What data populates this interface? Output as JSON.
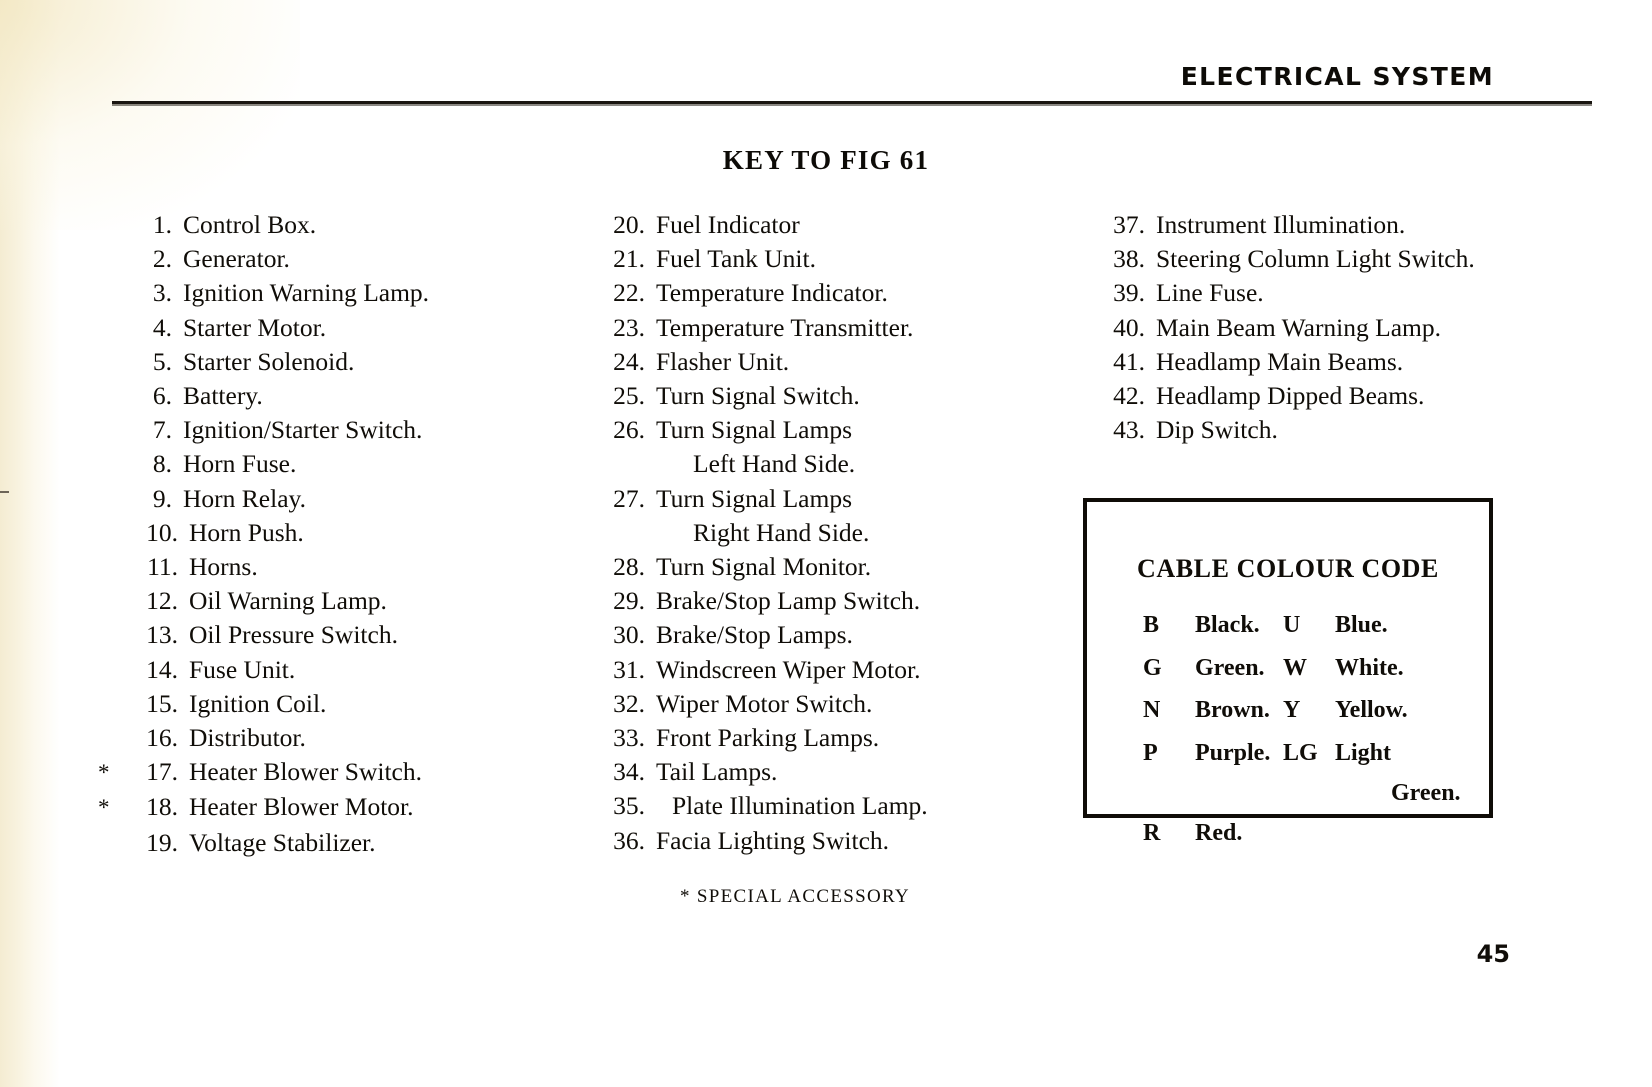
{
  "running_head": "ELECTRICAL SYSTEM",
  "key_title": "KEY TO FIG 61",
  "columns": [
    {
      "id": "column-1",
      "items": [
        {
          "star": "",
          "num": "1.",
          "label": "Control  Box."
        },
        {
          "star": "",
          "num": "2.",
          "label": "Generator."
        },
        {
          "star": "",
          "num": "3.",
          "label": "Ignition Warning Lamp."
        },
        {
          "star": "",
          "num": "4.",
          "label": "Starter Motor."
        },
        {
          "star": "",
          "num": "5.",
          "label": "Starter Solenoid."
        },
        {
          "star": "",
          "num": "6.",
          "label": "Battery."
        },
        {
          "star": "",
          "num": "7.",
          "label": "Ignition/Starter Switch."
        },
        {
          "star": "",
          "num": "8.",
          "label": "Horn Fuse."
        },
        {
          "star": "",
          "num": "9.",
          "label": "Horn Relay."
        },
        {
          "star": "",
          "num": "10.",
          "label": "Horn Push."
        },
        {
          "star": "",
          "num": "11.",
          "label": "Horns."
        },
        {
          "star": "",
          "num": "12.",
          "label": "Oil Warning Lamp."
        },
        {
          "star": "",
          "num": "13.",
          "label": "Oil Pressure Switch."
        },
        {
          "star": "",
          "num": "14.",
          "label": "Fuse Unit."
        },
        {
          "star": "",
          "num": "15.",
          "label": "Ignition Coil."
        },
        {
          "star": "",
          "num": "16.",
          "label": "Distributor."
        },
        {
          "star": "*",
          "num": "17.",
          "label": "Heater Blower Switch."
        },
        {
          "star": "*",
          "num": "18.",
          "label": "Heater Blower Motor."
        },
        {
          "star": "",
          "num": "19.",
          "label": "Voltage Stabilizer."
        }
      ]
    },
    {
      "id": "column-2",
      "items": [
        {
          "star": "",
          "num": "20.",
          "label": "Fuel Indicator"
        },
        {
          "star": "",
          "num": "21.",
          "label": "Fuel Tank Unit."
        },
        {
          "star": "",
          "num": "22.",
          "label": "Temperature Indicator."
        },
        {
          "star": "",
          "num": "23.",
          "label": "Temperature Transmitter."
        },
        {
          "star": "",
          "num": "24.",
          "label": "Flasher Unit."
        },
        {
          "star": "",
          "num": "25.",
          "label": "Turn Signal Switch."
        },
        {
          "star": "",
          "num": "26.",
          "label": "Turn Signal Lamps",
          "sub": "Left Hand Side."
        },
        {
          "star": "",
          "num": "27.",
          "label": "Turn Signal Lamps",
          "sub": "Right Hand Side."
        },
        {
          "star": "",
          "num": "28.",
          "label": "Turn Signal Monitor."
        },
        {
          "star": "",
          "num": "29.",
          "label": "Brake/Stop Lamp Switch."
        },
        {
          "star": "",
          "num": "30.",
          "label": "Brake/Stop Lamps."
        },
        {
          "star": "",
          "num": "31.",
          "label": "Windscreen Wiper Motor."
        },
        {
          "star": "",
          "num": "32.",
          "label": "Wiper Motor Switch."
        },
        {
          "star": "",
          "num": "33.",
          "label": "Front Parking Lamps."
        },
        {
          "star": "",
          "num": "34.",
          "label": "Tail Lamps."
        },
        {
          "star": "",
          "num": "35.",
          "label": "Plate Illumination Lamp.",
          "indent": true
        },
        {
          "star": "",
          "num": "36.",
          "label": "Facia Lighting Switch."
        }
      ]
    },
    {
      "id": "column-3",
      "items": [
        {
          "star": "",
          "num": "37.",
          "label": "Instrument Illumination."
        },
        {
          "star": "",
          "num": "38.",
          "label": "Steering Column Light Switch."
        },
        {
          "star": "",
          "num": "39.",
          "label": "Line Fuse."
        },
        {
          "star": "",
          "num": "40.",
          "label": "Main Beam Warning Lamp."
        },
        {
          "star": "",
          "num": "41.",
          "label": "Headlamp Main Beams."
        },
        {
          "star": "",
          "num": "42.",
          "label": "Headlamp Dipped Beams."
        },
        {
          "star": "",
          "num": "43.",
          "label": "Dip Switch."
        }
      ]
    }
  ],
  "cable_colour_code": {
    "title": "CABLE COLOUR CODE",
    "rows": [
      {
        "left_code": "B",
        "left_name": "Black.",
        "right_code": "U",
        "right_name": "Blue."
      },
      {
        "left_code": "G",
        "left_name": "Green.",
        "right_code": "W",
        "right_name": "White."
      },
      {
        "left_code": "N",
        "left_name": "Brown.",
        "right_code": "Y",
        "right_name": "Yellow."
      },
      {
        "left_code": "P",
        "left_name": "Purple.",
        "right_code": "LG",
        "right_name": "Light"
      },
      {
        "left_code": "R",
        "left_name": "Red.",
        "right_code": "",
        "right_name": ""
      }
    ],
    "continuation": "Green."
  },
  "footnote": "* SPECIAL  ACCESSORY",
  "page_number": "45"
}
